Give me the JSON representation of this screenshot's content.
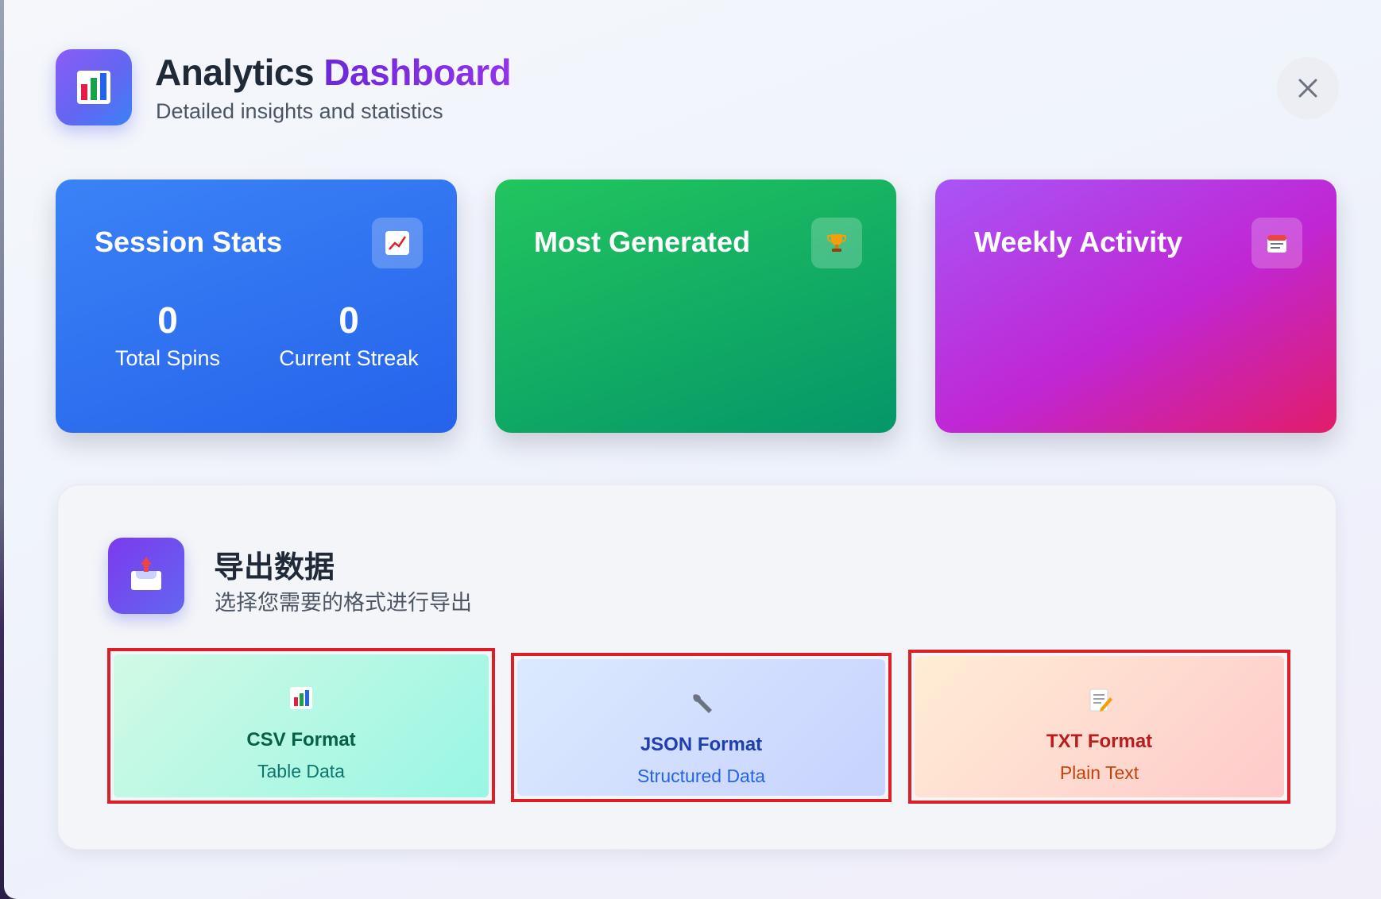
{
  "header": {
    "title_part1": "Analytics",
    "title_part2": "Dashboard",
    "subtitle": "Detailed insights and statistics",
    "app_icon": "bar-chart-icon",
    "close_icon": "close-icon"
  },
  "cards": {
    "session": {
      "title": "Session Stats",
      "icon": "chart-increasing-icon",
      "stats": [
        {
          "value": "0",
          "label": "Total Spins"
        },
        {
          "value": "0",
          "label": "Current Streak"
        }
      ]
    },
    "most_generated": {
      "title": "Most Generated",
      "icon": "trophy-icon"
    },
    "weekly": {
      "title": "Weekly Activity",
      "icon": "calendar-icon"
    }
  },
  "export": {
    "title": "导出数据",
    "subtitle": "选择您需要的格式进行导出",
    "icon": "outbox-tray-icon",
    "formats": [
      {
        "name": "CSV Format",
        "desc": "Table Data",
        "icon": "bar-chart-icon"
      },
      {
        "name": "JSON Format",
        "desc": "Structured Data",
        "icon": "wrench-icon"
      },
      {
        "name": "TXT Format",
        "desc": "Plain Text",
        "icon": "memo-icon"
      }
    ]
  },
  "colors": {
    "blue_card": "#2563eb",
    "green_card": "#16a34a",
    "purple_card": "#c026d3",
    "highlight_border": "#dc1f26"
  }
}
